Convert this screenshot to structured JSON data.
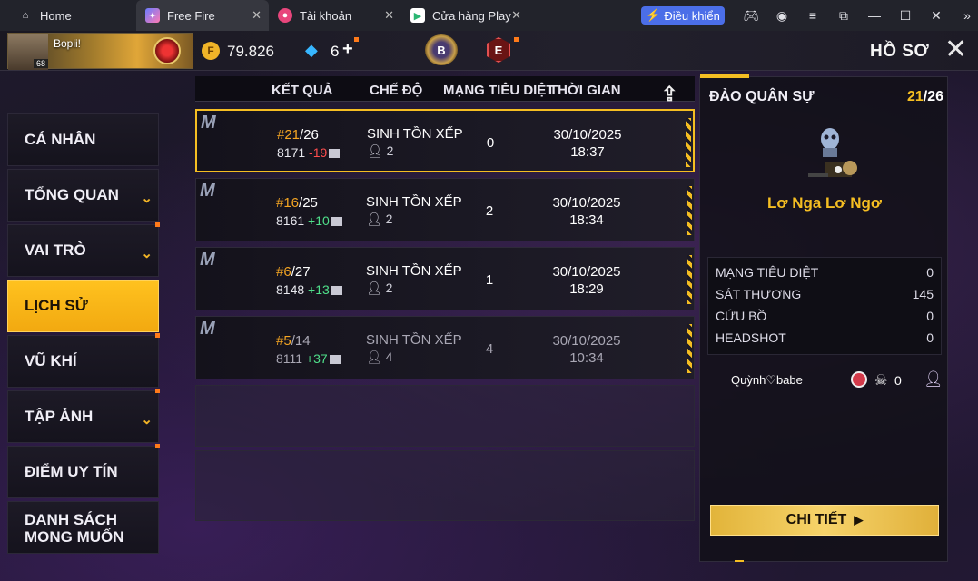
{
  "tabs": [
    {
      "label": "Home"
    },
    {
      "label": "Free Fire"
    },
    {
      "label": "Tài khoản"
    },
    {
      "label": "Cửa hàng Play"
    }
  ],
  "window": {
    "control_label": "Điều khiển"
  },
  "player": {
    "name": "Bopii!",
    "level": "68"
  },
  "currency": {
    "coins": "79.826",
    "diamonds": "6"
  },
  "badges": {
    "b_label": "B",
    "e_label": "E"
  },
  "page": {
    "title": "HỒ SƠ"
  },
  "menu": [
    {
      "label": "CÁ NHÂN"
    },
    {
      "label": "TỔNG QUAN"
    },
    {
      "label": "VAI TRÒ"
    },
    {
      "label": "LỊCH SỬ"
    },
    {
      "label": "VŨ KHÍ"
    },
    {
      "label": "TẬP ẢNH"
    },
    {
      "label": "ĐIỂM UY TÍN"
    },
    {
      "label": "DANH SÁCH MONG MUỐN"
    }
  ],
  "table": {
    "headers": {
      "result": "KẾT QUẢ",
      "mode": "CHẾ ĐỘ",
      "kills": "MẠNG TIÊU DIỆT",
      "time": "THỜI GIAN"
    },
    "rows": [
      {
        "rank": "#21",
        "total": "/26",
        "points": "8171",
        "delta": "-19",
        "mode": "SINH TỒN XẾP HẠNG",
        "party": "2",
        "kills": "0",
        "date": "30/10/2025",
        "time": "18:37"
      },
      {
        "rank": "#16",
        "total": "/25",
        "points": "8161",
        "delta": "+10",
        "mode": "SINH TỒN XẾP HẠNG",
        "party": "2",
        "kills": "2",
        "date": "30/10/2025",
        "time": "18:34"
      },
      {
        "rank": "#6",
        "total": "/27",
        "points": "8148",
        "delta": "+13",
        "mode": "SINH TỒN XẾP HẠNG",
        "party": "2",
        "kills": "1",
        "date": "30/10/2025",
        "time": "18:29"
      },
      {
        "rank": "#5",
        "total": "/14",
        "points": "8111",
        "delta": "+37",
        "mode": "SINH TỒN XẾP HẠNG",
        "party": "4",
        "kills": "4",
        "date": "30/10/2025",
        "time": "10:34"
      }
    ]
  },
  "detail": {
    "map": "ĐẢO QUÂN SỰ",
    "count_current": "21",
    "count_total": "/26",
    "player_title": "Lơ Nga Lơ Ngơ",
    "stats": [
      {
        "label": "MẠNG TIÊU DIỆT",
        "value": "0"
      },
      {
        "label": "SÁT THƯƠNG",
        "value": "145"
      },
      {
        "label": "CỨU BỒ",
        "value": "0"
      },
      {
        "label": "HEADSHOT",
        "value": "0"
      }
    ],
    "teammate": {
      "name": "Quỳnh♡babe",
      "value": "0"
    },
    "button_label": "CHI TIẾT"
  }
}
